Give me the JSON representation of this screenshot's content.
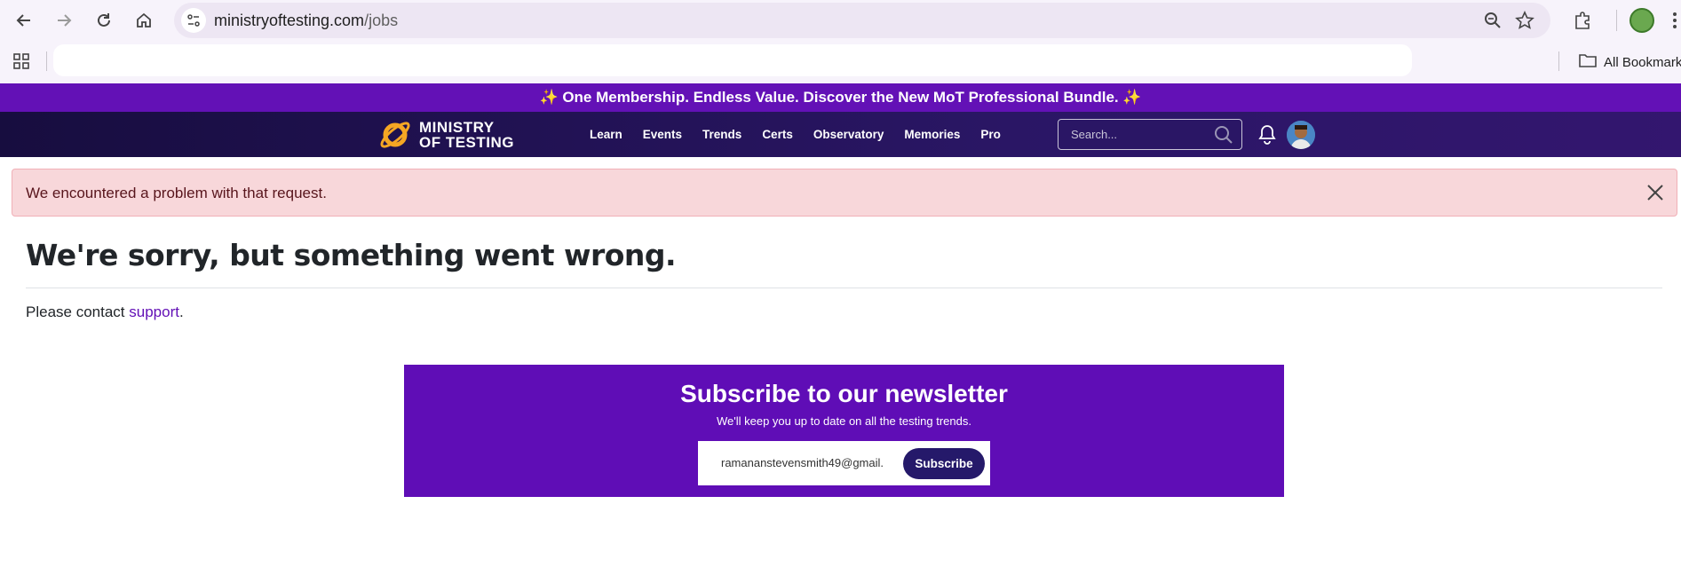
{
  "browser": {
    "url_domain": "ministryoftesting.com",
    "url_path": "/jobs",
    "bookmarks_label": "All Bookmark"
  },
  "promo": {
    "text": "✨ One Membership. Endless Value. Discover the New MoT Professional Bundle. ✨"
  },
  "header": {
    "logo_line1": "MINISTRY",
    "logo_line2": "OF TESTING",
    "nav": [
      "Learn",
      "Events",
      "Trends",
      "Certs",
      "Observatory",
      "Memories",
      "Pro"
    ],
    "search_placeholder": "Search..."
  },
  "alert": {
    "message": "We encountered a problem with that request."
  },
  "main": {
    "headline": "We're sorry, but something went wrong.",
    "contact_prefix": "Please contact ",
    "contact_link": "support",
    "contact_suffix": "."
  },
  "newsletter": {
    "title": "Subscribe to our newsletter",
    "subtitle": "We'll keep you up to date on all the testing trends.",
    "email_value": "ramananstevensmith49@gmail.",
    "button": "Subscribe"
  },
  "colors": {
    "brand_purple": "#6311b6",
    "header_dark": "#170d3f",
    "alert_bg": "#f8d7da",
    "button_navy": "#25196a"
  }
}
